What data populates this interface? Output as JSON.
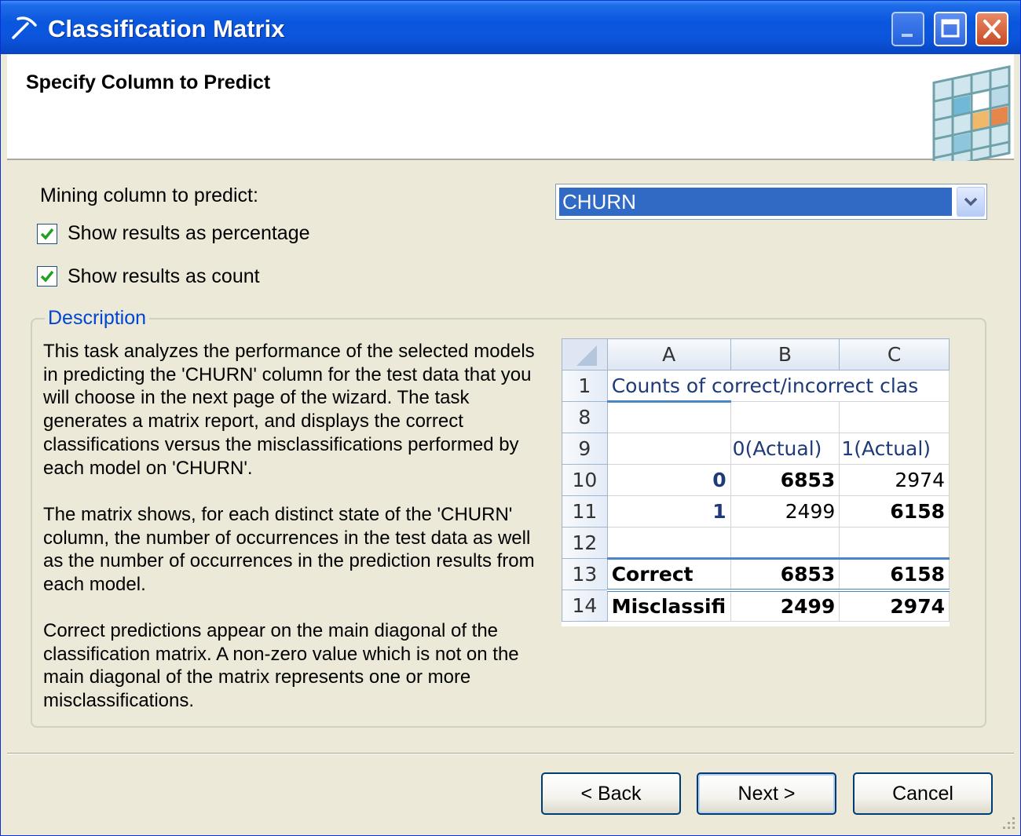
{
  "window": {
    "title": "Classification Matrix",
    "controls": [
      "minimize",
      "maximize",
      "close"
    ]
  },
  "header": {
    "title": "Specify Column to Predict"
  },
  "form": {
    "mining_column_label": "Mining column to predict:",
    "mining_column_value": "CHURN",
    "show_percentage": {
      "label": "Show results as percentage",
      "checked": true
    },
    "show_count": {
      "label": "Show results as count",
      "checked": true
    }
  },
  "description": {
    "legend": "Description",
    "paragraphs": [
      "This task analyzes the performance of the selected models in predicting the 'CHURN' column for the test data that you will choose in the next page of the wizard. The task generates a matrix report, and displays the correct classifications versus the misclassifications performed by each model on 'CHURN'.",
      "The matrix shows, for each distinct state of the 'CHURN' column, the number of occurrences in the test data as well as the number of occurrences in the prediction results from each model.",
      "Correct predictions appear on the main diagonal of the classification matrix. A non-zero value which is not on the main diagonal of the matrix represents one or more misclassifications."
    ]
  },
  "sheet": {
    "columns": [
      "A",
      "B",
      "C"
    ],
    "rows": {
      "r1": {
        "num": "1",
        "a": "Counts of correct/incorrect clas"
      },
      "r8": {
        "num": "8",
        "a": "",
        "b": "",
        "c": ""
      },
      "r9": {
        "num": "9",
        "a": "",
        "b": "0(Actual)",
        "c": "1(Actual)"
      },
      "r10": {
        "num": "10",
        "a": "0",
        "b": "6853",
        "c": "2974"
      },
      "r11": {
        "num": "11",
        "a": "1",
        "b": "2499",
        "c": "6158"
      },
      "r12": {
        "num": "12",
        "a": "",
        "b": "",
        "c": ""
      },
      "r13": {
        "num": "13",
        "a": "Correct",
        "b": "6853",
        "c": "6158"
      },
      "r14": {
        "num": "14",
        "a": "Misclassifi",
        "b": "2499",
        "c": "2974"
      }
    }
  },
  "buttons": {
    "back": "< Back",
    "next": "Next >",
    "cancel": "Cancel"
  },
  "colors": {
    "titlebar": "#0a57df",
    "selection": "#316ac5",
    "dialog_bg": "#ece9d8",
    "legend_text": "#0046d5"
  }
}
